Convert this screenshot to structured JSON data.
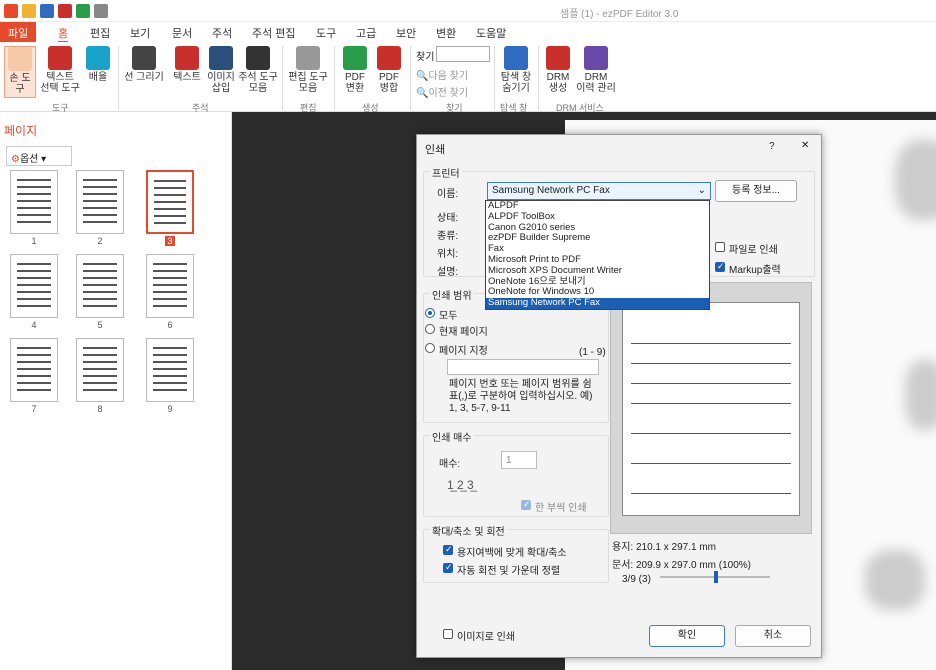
{
  "app": {
    "title": "샘플 (1) - ezPDF Editor 3.0"
  },
  "tabs": [
    {
      "label": "파일"
    },
    {
      "label": "홈"
    },
    {
      "label": "편집"
    },
    {
      "label": "보기"
    },
    {
      "label": "문서"
    },
    {
      "label": "주석"
    },
    {
      "label": "주석 편집"
    },
    {
      "label": "도구"
    },
    {
      "label": "고급"
    },
    {
      "label": "보안"
    },
    {
      "label": "변환"
    },
    {
      "label": "도움말"
    }
  ],
  "ribbon": {
    "hand": "손 도구",
    "text_select": "텍스트\n선택 도구",
    "layout": "배율",
    "line_draw": "선 그리기",
    "text": "텍스트",
    "image_insert": "이미지\n삽입",
    "annot_tool": "주석 도구\n모음",
    "edit_tool": "편집 도구\n모음",
    "pdf_convert": "PDF\n변환",
    "pdf_merge": "PDF\n병합",
    "find_label": "찾기",
    "find_next": "다음 찾기",
    "find_prev": "이전 찾기",
    "nav_hide": "탐색 창\n숨기기",
    "drm_create": "DRM\n생성",
    "drm_history": "DRM\n이력 관리",
    "groups": {
      "tool": "도구",
      "annot": "주석",
      "edit": "편집",
      "create": "생성",
      "find": "찾기",
      "nav": "탐색 창",
      "drm": "DRM 서비스"
    }
  },
  "left": {
    "title": "페이지",
    "options": "옵션",
    "pages": [
      "1",
      "2",
      "3",
      "4",
      "5",
      "6",
      "7",
      "8",
      "9"
    ],
    "selected_page": "3"
  },
  "dialog": {
    "title": "인쇄",
    "help": "?",
    "close": "✕",
    "printer_group": "프린터",
    "name_label": "이름:",
    "selected_printer": "Samsung Network PC Fax",
    "props_button": "등록 정보...",
    "status_label": "상태:",
    "type_label": "종류:",
    "where_label": "위치:",
    "comment_label": "설명:",
    "print_to_file": "파일로 인쇄",
    "markup_output": "Markup출력",
    "printers": [
      "ALPDF",
      "ALPDF ToolBox",
      "Canon G2010 series",
      "ezPDF Builder Supreme",
      "Fax",
      "Microsoft Print to PDF",
      "Microsoft XPS Document Writer",
      "OneNote 16으로 보내기",
      "OneNote for Windows 10",
      "Samsung Network PC Fax"
    ],
    "range_group": "인쇄 범위",
    "range_all": "모두",
    "range_current": "현재 페이지",
    "range_pages": "페이지 지정",
    "range_hint": "(1 - 9)",
    "range_help": "페이지 번호 또는 페이지 범위를 쉼표(,)로 구분하여 입력하십시오. 예) 1, 3, 5-7, 9-11",
    "copies_group": "인쇄 매수",
    "copies_label": "매수:",
    "copies_value": "1",
    "collate": "한 부씩 인쇄",
    "scale_group": "확대/축소 및 회전",
    "fit_margin": "용지여백에 맞게 확대/축소",
    "auto_rotate": "자동 회전 및 가운데 정렬",
    "paper_size": "용지: 210.1 x 297.1 mm",
    "doc_size": "문서: 209.9 x 297.0 mm (100%)",
    "page_indicator": "3/9 (3)",
    "print_as_image": "이미지로 인쇄",
    "ok": "확인",
    "cancel": "취소"
  },
  "colors": {
    "accent": "#e64a2a",
    "select": "#1a5fb4"
  }
}
